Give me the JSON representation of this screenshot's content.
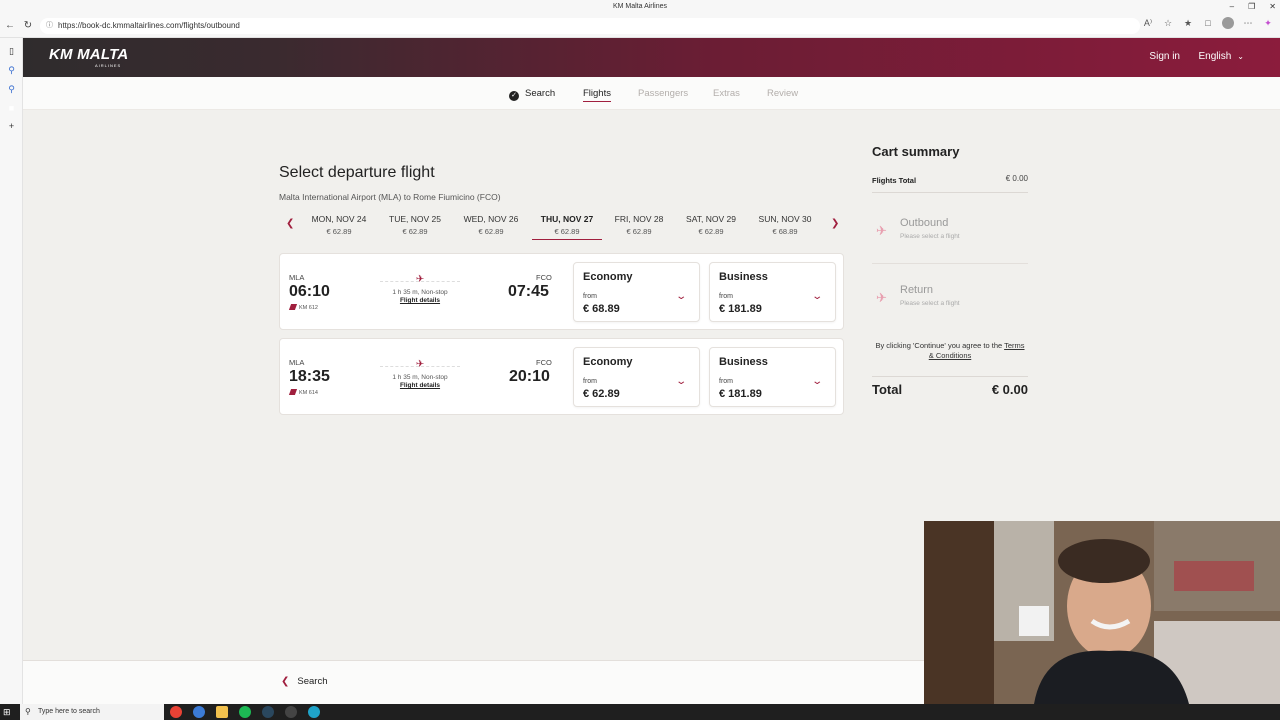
{
  "browser": {
    "window_title": "KM Malta Airlines",
    "url": "https://book-dc.kmmaltairlines.com/flights/outbound"
  },
  "header": {
    "logo_text": "KM MALTA",
    "logo_sub": "AIRLINES",
    "sign_in": "Sign in",
    "language": "English"
  },
  "steps": [
    {
      "label": "Search",
      "state": "done"
    },
    {
      "label": "Flights",
      "state": "active"
    },
    {
      "label": "Passengers",
      "state": "inactive"
    },
    {
      "label": "Extras",
      "state": "inactive"
    },
    {
      "label": "Review",
      "state": "inactive"
    }
  ],
  "main": {
    "title": "Select departure flight",
    "route": "Malta International Airport (MLA) to Rome Fiumicino (FCO)"
  },
  "dates": [
    {
      "day": "MON, NOV 24",
      "price": "€ 62.89"
    },
    {
      "day": "TUE, NOV 25",
      "price": "€ 62.89"
    },
    {
      "day": "WED, NOV 26",
      "price": "€ 62.89"
    },
    {
      "day": "THU, NOV 27",
      "price": "€ 62.89",
      "selected": true
    },
    {
      "day": "FRI, NOV 28",
      "price": "€ 62.89"
    },
    {
      "day": "SAT, NOV 29",
      "price": "€ 62.89"
    },
    {
      "day": "SUN, NOV 30",
      "price": "€ 68.89"
    }
  ],
  "flights": [
    {
      "origin": "MLA",
      "depart": "06:10",
      "dest": "FCO",
      "arrive": "07:45",
      "flight_no": "KM 612",
      "duration": "1 h 35 m, Non-stop",
      "details": "Flight details",
      "economy": {
        "label": "Economy",
        "from": "from",
        "price": "€ 68.89"
      },
      "business": {
        "label": "Business",
        "from": "from",
        "price": "€ 181.89"
      }
    },
    {
      "origin": "MLA",
      "depart": "18:35",
      "dest": "FCO",
      "arrive": "20:10",
      "flight_no": "KM 614",
      "duration": "1 h 35 m, Non-stop",
      "details": "Flight details",
      "economy": {
        "label": "Economy",
        "from": "from",
        "price": "€ 62.89"
      },
      "business": {
        "label": "Business",
        "from": "from",
        "price": "€ 181.89"
      }
    }
  ],
  "cart": {
    "title": "Cart summary",
    "flights_total_label": "Flights Total",
    "flights_total_value": "€ 0.00",
    "outbound": {
      "title": "Outbound",
      "sub": "Please select a flight"
    },
    "return": {
      "title": "Return",
      "sub": "Please select a flight"
    },
    "terms_prefix": "By clicking 'Continue' you agree to the",
    "terms_link": "Terms & Conditions",
    "total_label": "Total",
    "total_value": "€ 0.00"
  },
  "footer": {
    "back_label": "Search"
  },
  "taskbar": {
    "search_placeholder": "Type here to search"
  },
  "colors": {
    "accent": "#a01f3e",
    "header_dark": "#2f2c2d",
    "header_red": "#8b1c3c"
  }
}
